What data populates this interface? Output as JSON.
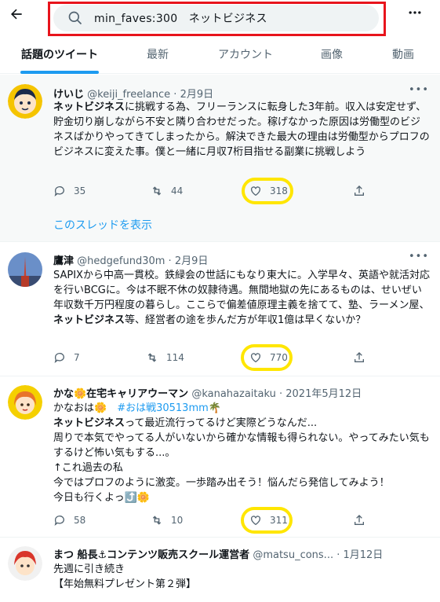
{
  "header": {
    "back_icon": "arrow-left-icon",
    "search_query": "min_faves:300　ネットビジネス",
    "more_icon": "more-horizontal-icon",
    "highlight_color": "#e8141c"
  },
  "tabs": [
    {
      "label": "話題のツイート",
      "active": true
    },
    {
      "label": "最新",
      "active": false
    },
    {
      "label": "アカウント",
      "active": false
    },
    {
      "label": "画像",
      "active": false
    },
    {
      "label": "動画",
      "active": false
    }
  ],
  "tweets": [
    {
      "name": "けいじ",
      "handle": "@keiji_freelance",
      "date": "2月9日",
      "text_keyword": "ネットビジネス",
      "text_rest": "に挑戦する為、フリーランスに転身した3年前。収入は安定せず、貯金切り崩しながら不安と隣り合わせだった。稼げなかった原因は労働型のビジネスばかりやってきてしまったから。解決できた最大の理由は労働型からプロフのビジネスに変えた事。僕と一緒に月収7桁目指せる副業に挑戦しよう",
      "replies": "35",
      "retweets": "44",
      "likes": "318",
      "thread_link": "このスレッドを表示"
    },
    {
      "name": "鷹津",
      "handle": "@hedgefund30m",
      "date": "2月9日",
      "text_before": "SAPIXから中高一貫校。鉄緑会の世話にもなり東大に。入学早々、英語や就活対応を行いBCGに。今は不眠不休の奴隷待遇。無間地獄の先にあるものは、せいぜい年収数千万円程度の暮らし。ここらで偏差値原理主義を捨てて、塾、ラーメン屋、",
      "text_keyword": "ネットビジネス",
      "text_after": "等、経営者の途を歩んだ方が年収1億は早くないか？",
      "replies": "7",
      "retweets": "114",
      "likes": "770"
    },
    {
      "name": "かな🌼在宅キャリアウーマン",
      "handle": "@kanahazaitaku",
      "date": "2021年5月12日",
      "line1_text": "かなおは🌼",
      "line1_tag": "#おは戦30513mm",
      "line1_emoji": "🌴",
      "line2_keyword": "ネットビジネス",
      "line2_rest": "って最近流行ってるけど実際どうなんだ...",
      "line3": "周りで本気でやってる人がいないから確かな情報も得られない。やってみたい気もするけど怖い気もする...。",
      "line4": "↑これ過去の私",
      "line5": "今ではプロフのように激変。一歩踏み出そう！悩んだら発信してみよう！",
      "line6": "今日も行くよっ⤴️🌼",
      "replies": "58",
      "retweets": "10",
      "likes": "311"
    },
    {
      "name": "まつ 船長⚓コンテンツ販売スクール運営者",
      "handle": "@matsu_cons...",
      "date": "1月12日",
      "line1": "先週に引き続き",
      "line2": "【年始無料プレゼント第２弾】"
    }
  ],
  "colors": {
    "accent": "#1d9bf0",
    "like_ring": "#ffe600",
    "muted": "#536471"
  }
}
